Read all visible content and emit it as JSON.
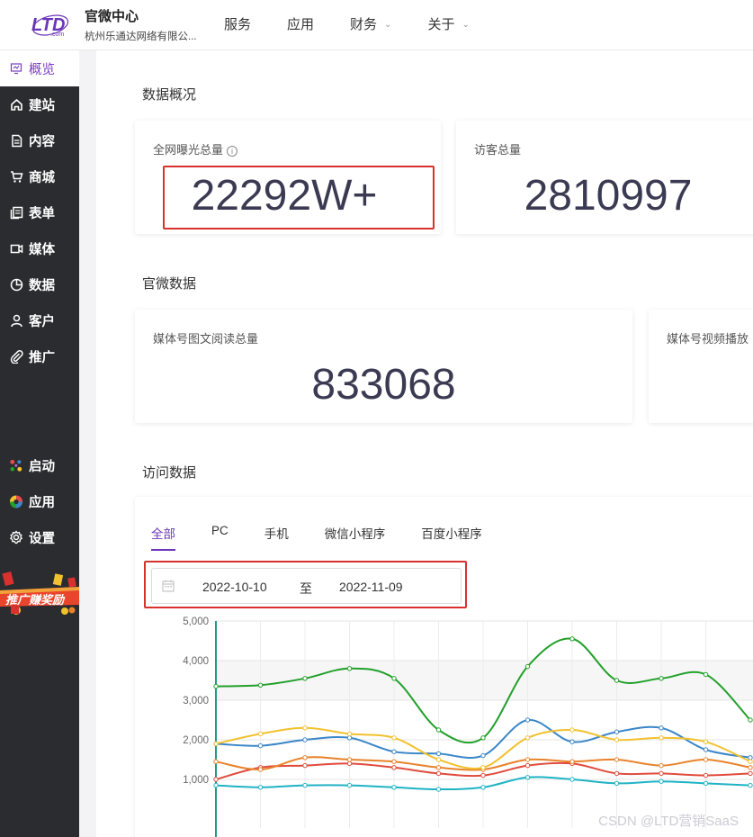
{
  "header": {
    "logo_text": "LTD .com",
    "brand_name": "官微中心",
    "company": "杭州乐通达网络有限公...",
    "nav": [
      {
        "label": "服务",
        "has_dropdown": false
      },
      {
        "label": "应用",
        "has_dropdown": false
      },
      {
        "label": "财务",
        "has_dropdown": true
      },
      {
        "label": "关于",
        "has_dropdown": true
      }
    ]
  },
  "sidebar": {
    "active_label": "概览",
    "items": [
      {
        "label": "建站",
        "icon": "home-icon"
      },
      {
        "label": "内容",
        "icon": "document-icon"
      },
      {
        "label": "商城",
        "icon": "cart-icon"
      },
      {
        "label": "表单",
        "icon": "form-icon"
      },
      {
        "label": "媒体",
        "icon": "video-icon"
      },
      {
        "label": "数据",
        "icon": "pie-chart-icon"
      },
      {
        "label": "客户",
        "icon": "user-icon"
      },
      {
        "label": "推广",
        "icon": "paperclip-icon"
      }
    ],
    "bottom_items": [
      {
        "label": "启动",
        "icon": "launch-dots-icon"
      },
      {
        "label": "应用",
        "icon": "apps-color-icon"
      },
      {
        "label": "设置",
        "icon": "gear-icon"
      }
    ],
    "promo_label": "推广赚奖励"
  },
  "overview": {
    "title": "数据概况",
    "cards": [
      {
        "label": "全网曝光总量",
        "value": "22292W+"
      },
      {
        "label": "访客总量",
        "value": "2810997"
      }
    ]
  },
  "official": {
    "title": "官微数据",
    "cards": [
      {
        "label": "媒体号图文阅读总量",
        "value": "833068"
      },
      {
        "label": "媒体号视频播放",
        "value": ""
      }
    ]
  },
  "visits": {
    "title": "访问数据",
    "tabs": [
      "全部",
      "PC",
      "手机",
      "微信小程序",
      "百度小程序"
    ],
    "active_tab": 0,
    "date_from": "2022-10-10",
    "date_sep": "至",
    "date_to": "2022-11-09"
  },
  "colors": {
    "accent": "#6a36b8",
    "sidebar_bg": "#2b2c30",
    "highlight_box": "#d9312e"
  },
  "chart_data": {
    "type": "line",
    "yticks": [
      "5,000",
      "4,000",
      "3,000",
      "2,000",
      "1,000"
    ],
    "ylim": [
      0,
      5000
    ],
    "grid": true,
    "series": [
      {
        "color": "#22a02a",
        "values": [
          3350,
          3380,
          3550,
          3800,
          3550,
          2250,
          2050,
          3850,
          4550,
          3500,
          3550,
          3650,
          2500
        ]
      },
      {
        "color": "#f2c12e",
        "values": [
          1900,
          2150,
          2300,
          2150,
          2050,
          1500,
          1300,
          2050,
          2250,
          2000,
          2050,
          1950,
          1450
        ]
      },
      {
        "color": "#3a86c8",
        "values": [
          1900,
          1850,
          2000,
          2050,
          1700,
          1650,
          1600,
          2500,
          1950,
          2200,
          2300,
          1750,
          1550
        ]
      },
      {
        "color": "#e8822a",
        "values": [
          1450,
          1250,
          1550,
          1500,
          1450,
          1300,
          1250,
          1500,
          1450,
          1500,
          1350,
          1500,
          1300
        ]
      },
      {
        "color": "#e04b3c",
        "values": [
          1000,
          1300,
          1350,
          1400,
          1300,
          1150,
          1100,
          1350,
          1400,
          1150,
          1150,
          1100,
          1150
        ]
      },
      {
        "color": "#1fb3c4",
        "values": [
          850,
          800,
          850,
          850,
          800,
          750,
          800,
          1050,
          1000,
          900,
          950,
          900,
          850
        ]
      }
    ]
  },
  "watermark": "CSDN @LTD营销SaaS"
}
